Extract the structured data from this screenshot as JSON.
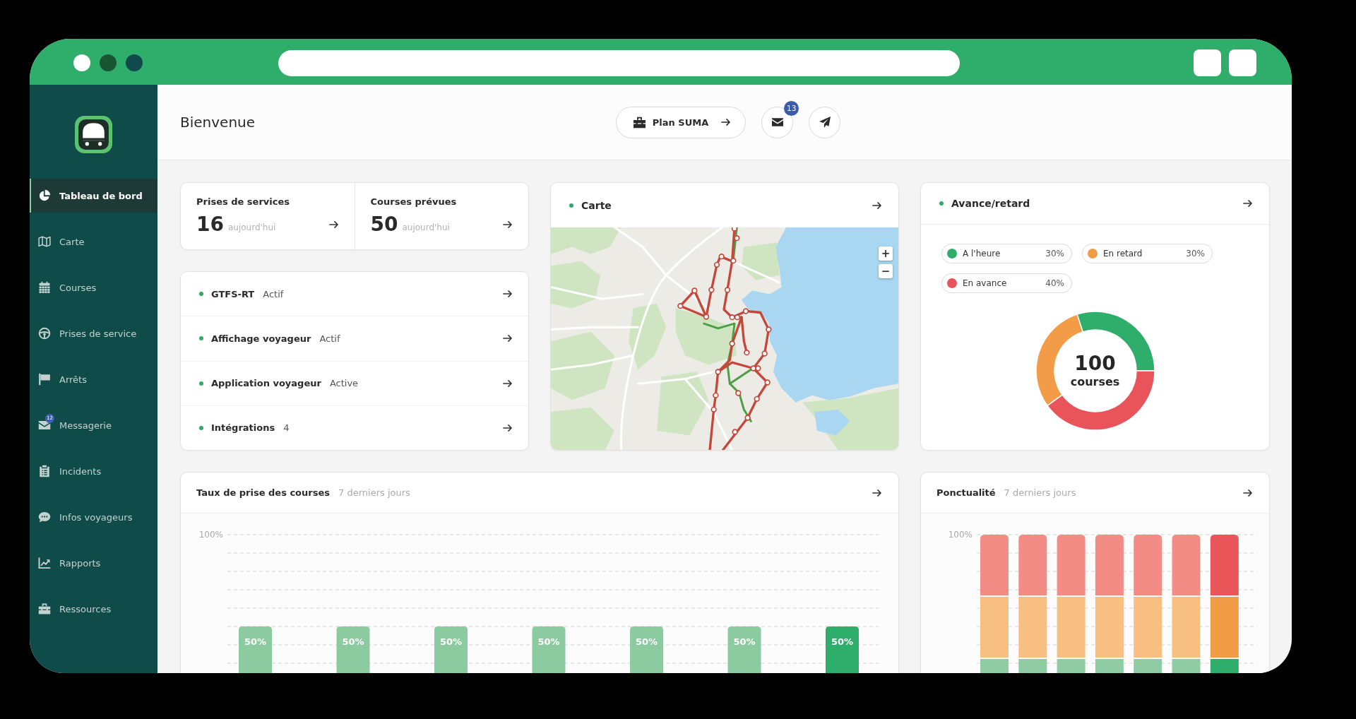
{
  "sidebar": {
    "items": [
      {
        "label": "Tableau de bord",
        "selected": true
      },
      {
        "label": "Carte",
        "selected": false
      },
      {
        "label": "Courses",
        "selected": false
      },
      {
        "label": "Prises de service",
        "selected": false
      },
      {
        "label": "Arrêts",
        "selected": false
      },
      {
        "label": "Messagerie",
        "selected": false,
        "badge": "12"
      },
      {
        "label": "Incidents",
        "selected": false
      },
      {
        "label": "Infos voyageurs",
        "selected": false
      },
      {
        "label": "Rapports",
        "selected": false
      },
      {
        "label": "Ressources",
        "selected": false
      }
    ]
  },
  "header": {
    "title": "Bienvenue",
    "plan_button": "Plan SUMA",
    "messages_badge": "13"
  },
  "stats": [
    {
      "title": "Prises de services",
      "value": "16",
      "unit": "aujourd'hui"
    },
    {
      "title": "Courses prévues",
      "value": "50",
      "unit": "aujourd'hui"
    }
  ],
  "services": [
    {
      "label": "GTFS-RT",
      "value": "Actif"
    },
    {
      "label": "Affichage voyageur",
      "value": "Actif"
    },
    {
      "label": "Application voyageur",
      "value": "Active"
    },
    {
      "label": "Intégrations",
      "value": "4"
    }
  ],
  "map_card": {
    "title": "Carte",
    "zoom_controls": [
      "+",
      "−"
    ]
  },
  "delay_card": {
    "title": "Avance/retard",
    "legend": [
      {
        "label": "A l'heure",
        "percent": "30%",
        "color": "#2fae6b"
      },
      {
        "label": "En retard",
        "percent": "30%",
        "color": "#f29c48"
      },
      {
        "label": "En avance",
        "percent": "40%",
        "color": "#e9545a"
      }
    ],
    "total": "100",
    "total_label": "courses",
    "chart_data": {
      "type": "donut",
      "values": [
        30,
        30,
        40
      ]
    }
  },
  "rate_card": {
    "title": "Taux de prise des courses",
    "period": "7 derniers jours",
    "chart_data": {
      "type": "bar",
      "values": [
        50,
        50,
        50,
        50,
        50,
        50,
        50
      ],
      "value_labels": [
        "50%",
        "50%",
        "50%",
        "50%",
        "50%",
        "50%",
        "50%"
      ],
      "colors": [
        "#8ccaa0",
        "#8ccaa0",
        "#8ccaa0",
        "#8ccaa0",
        "#8ccaa0",
        "#8ccaa0",
        "#2fae6b"
      ],
      "annotations": [
        "100%"
      ]
    }
  },
  "punctuality_card": {
    "title": "Ponctualité",
    "period": "7 derniers jours",
    "y_label": "100%",
    "bars": [
      {
        "highlighted": false
      },
      {
        "highlighted": false
      },
      {
        "highlighted": false
      },
      {
        "highlighted": false
      },
      {
        "highlighted": false
      },
      {
        "highlighted": false
      },
      {
        "highlighted": true
      }
    ]
  }
}
